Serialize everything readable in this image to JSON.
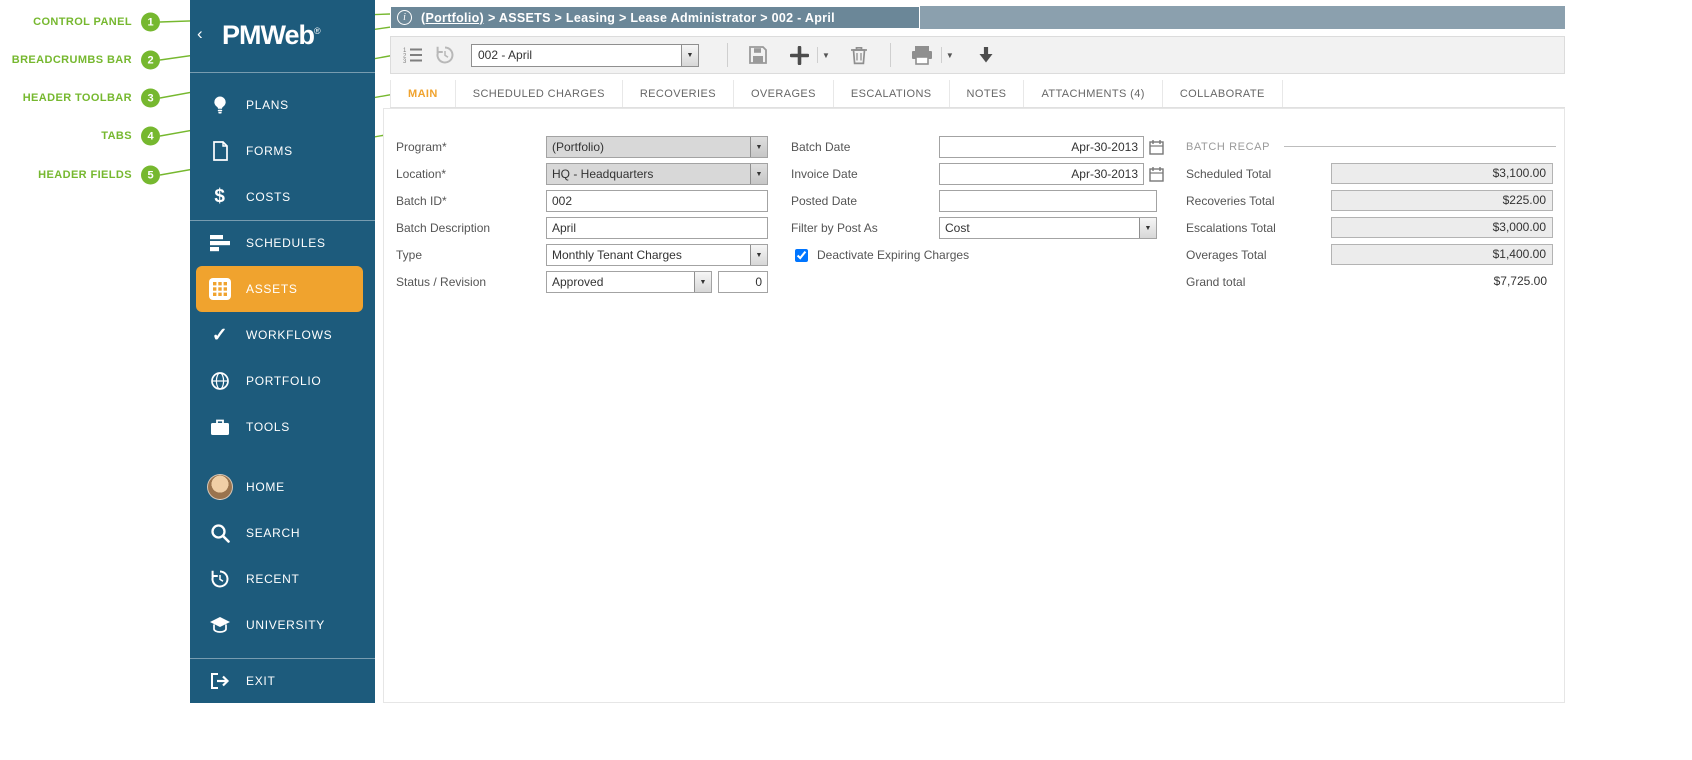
{
  "colors": {
    "sidebar_blue": "#1d5b7c",
    "accent_orange": "#f0a32e",
    "annotation_green": "#76b82f",
    "breadcrumb_outer": "#8ba0ae",
    "breadcrumb_inner": "#6b8798"
  },
  "annotations": {
    "items": [
      {
        "num": "1",
        "label": "CONTROL PANEL"
      },
      {
        "num": "2",
        "label": "BREADCRUMBS BAR"
      },
      {
        "num": "3",
        "label": "HEADER TOOLBAR"
      },
      {
        "num": "4",
        "label": "TABS"
      },
      {
        "num": "5",
        "label": "HEADER FIELDS"
      }
    ]
  },
  "sidebar": {
    "collapse": "‹",
    "logo": "PMWeb",
    "logo_reg": "®",
    "items": [
      {
        "label": "PLANS",
        "icon": "lightbulb-icon"
      },
      {
        "label": "FORMS",
        "icon": "document-icon"
      },
      {
        "label": "COSTS",
        "icon": "dollar-icon"
      },
      {
        "label": "SCHEDULES",
        "icon": "schedule-bars-icon"
      },
      {
        "label": "ASSETS",
        "icon": "assets-grid-icon",
        "active": true
      },
      {
        "label": "WORKFLOWS",
        "icon": "check-icon"
      },
      {
        "label": "PORTFOLIO",
        "icon": "globe-icon"
      },
      {
        "label": "TOOLS",
        "icon": "briefcase-icon"
      }
    ],
    "footer_items": [
      {
        "label": "HOME",
        "icon": "avatar"
      },
      {
        "label": "SEARCH",
        "icon": "search-icon"
      },
      {
        "label": "RECENT",
        "icon": "history-icon"
      },
      {
        "label": "UNIVERSITY",
        "icon": "graduation-cap-icon"
      },
      {
        "label": "EXIT",
        "icon": "exit-icon"
      }
    ]
  },
  "breadcrumbs": {
    "link": "(Portfolio)",
    "rest": "> ASSETS > Leasing > Lease Administrator > 002 - April"
  },
  "toolbar": {
    "record_selector": "002 - April",
    "icons": [
      "numbered-list-icon",
      "history-icon",
      "save-icon",
      "add-icon",
      "delete-icon",
      "print-icon",
      "download-icon"
    ]
  },
  "tabs": [
    {
      "label": "MAIN",
      "active": true
    },
    {
      "label": "SCHEDULED CHARGES"
    },
    {
      "label": "RECOVERIES"
    },
    {
      "label": "OVERAGES"
    },
    {
      "label": "ESCALATIONS"
    },
    {
      "label": "NOTES"
    },
    {
      "label": "ATTACHMENTS (4)"
    },
    {
      "label": "COLLABORATE"
    }
  ],
  "form": {
    "program": {
      "label": "Program*",
      "value": "(Portfolio)"
    },
    "location": {
      "label": "Location*",
      "value": "HQ - Headquarters"
    },
    "batch_id": {
      "label": "Batch ID*",
      "value": "002"
    },
    "batch_description": {
      "label": "Batch Description",
      "value": "April"
    },
    "type": {
      "label": "Type",
      "value": "Monthly Tenant Charges"
    },
    "status": {
      "label": "Status / Revision",
      "value": "Approved",
      "revision": "0"
    },
    "batch_date": {
      "label": "Batch Date",
      "value": "Apr-30-2013"
    },
    "invoice_date": {
      "label": "Invoice Date",
      "value": "Apr-30-2013"
    },
    "posted_date": {
      "label": "Posted Date",
      "value": ""
    },
    "filter_by_post_as": {
      "label": "Filter by Post As",
      "value": "Cost"
    },
    "deactivate_expiring": {
      "label": "Deactivate Expiring Charges",
      "checked": true
    }
  },
  "recap": {
    "title": "BATCH RECAP",
    "scheduled": {
      "label": "Scheduled Total",
      "value": "$3,100.00"
    },
    "recoveries": {
      "label": "Recoveries Total",
      "value": "$225.00"
    },
    "escalations": {
      "label": "Escalations Total",
      "value": "$3,000.00"
    },
    "overages": {
      "label": "Overages Total",
      "value": "$1,400.00"
    },
    "grand": {
      "label": "Grand total",
      "value": "$7,725.00"
    }
  }
}
